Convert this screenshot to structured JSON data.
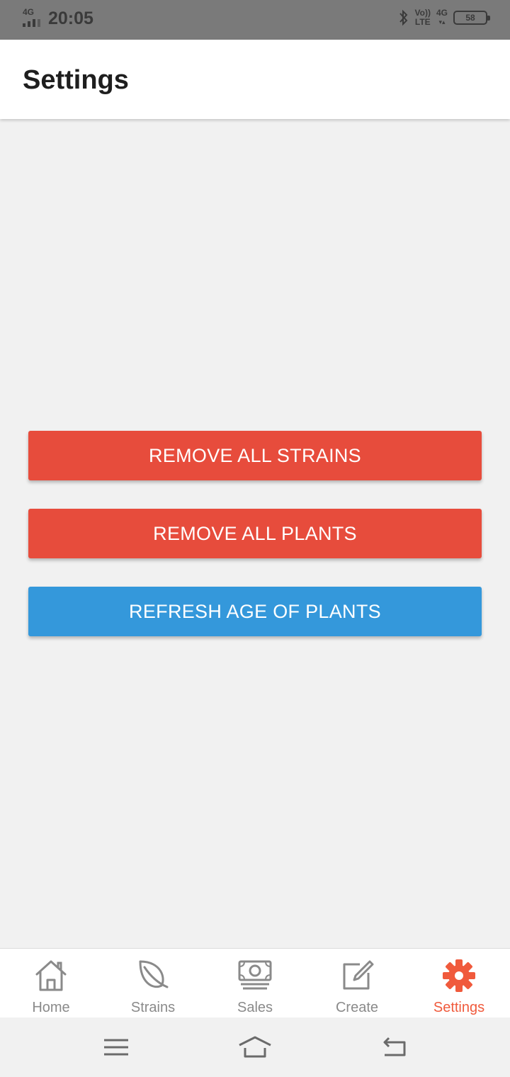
{
  "status_bar": {
    "network_left": "4G",
    "time": "20:05",
    "volte_top": "Vo))",
    "volte_bottom": "LTE",
    "network_right": "4G",
    "battery": "58"
  },
  "header": {
    "title": "Settings"
  },
  "actions": {
    "remove_strains": "REMOVE ALL STRAINS",
    "remove_plants": "REMOVE ALL PLANTS",
    "refresh_age": "REFRESH AGE OF PLANTS"
  },
  "tabs": [
    {
      "label": "Home",
      "icon": "home-icon"
    },
    {
      "label": "Strains",
      "icon": "leaf-icon"
    },
    {
      "label": "Sales",
      "icon": "cash-icon"
    },
    {
      "label": "Create",
      "icon": "edit-icon"
    },
    {
      "label": "Settings",
      "icon": "gear-icon",
      "active": true
    }
  ],
  "colors": {
    "danger": "#e74c3c",
    "primary": "#3498db",
    "active_tab": "#f05a3c",
    "inactive_tab": "#8a8a8a"
  }
}
